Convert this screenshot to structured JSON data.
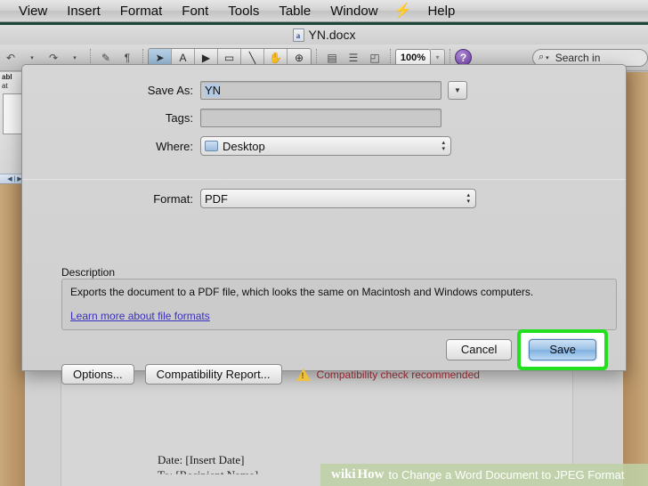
{
  "menubar": {
    "items": [
      {
        "label": "View",
        "name": "menu-view"
      },
      {
        "label": "Insert",
        "name": "menu-insert"
      },
      {
        "label": "Format",
        "name": "menu-format"
      },
      {
        "label": "Font",
        "name": "menu-font"
      },
      {
        "label": "Tools",
        "name": "menu-tools"
      },
      {
        "label": "Table",
        "name": "menu-table"
      },
      {
        "label": "Window",
        "name": "menu-window"
      },
      {
        "label": "Help",
        "name": "menu-help"
      }
    ],
    "flash_icon": "⚡"
  },
  "window": {
    "title": "YN.docx",
    "doc_icon_letter": "a"
  },
  "toolbar": {
    "undo_icon": "↶",
    "redo_icon": "↷",
    "brush_icon": "✎",
    "pilcrow_icon": "¶",
    "tools": [
      {
        "icon": "➤",
        "name": "select-arrow-tool"
      },
      {
        "icon": "A",
        "name": "text-box-tool"
      },
      {
        "icon": "▶",
        "name": "media-tool"
      },
      {
        "icon": "▭",
        "name": "shape-tool"
      },
      {
        "icon": "╲",
        "name": "line-tool"
      },
      {
        "icon": "✋",
        "name": "hand-tool"
      },
      {
        "icon": "⊕",
        "name": "zoom-tool"
      }
    ],
    "sidebar_icon": "▤",
    "notebook_icon": "☰",
    "media_icon": "◰",
    "zoom_value": "100%",
    "zoom_stepper_icon": "▾",
    "help_icon": "?",
    "search_icon": "⌕",
    "search_arrow_icon": "▾",
    "search_placeholder": "Search in"
  },
  "dialog": {
    "save_as": {
      "label": "Save As:",
      "value": "YN",
      "dropdown_icon": "▼"
    },
    "tags": {
      "label": "Tags:",
      "value": "",
      "placeholder": ""
    },
    "where": {
      "label": "Where:",
      "value": "Desktop",
      "stepper_up": "▴",
      "stepper_down": "▾"
    },
    "format": {
      "label": "Format:",
      "value": "PDF",
      "stepper_up": "▴",
      "stepper_down": "▾"
    },
    "description": {
      "label": "Description",
      "text": "Exports the document to a PDF file, which looks the same on Macintosh and Windows computers.",
      "link": "Learn more about file formats"
    },
    "buttons": {
      "options": "Options...",
      "compatibility_report": "Compatibility Report...",
      "warning_icon": "warning-triangle-icon",
      "warning_text": "Compatibility check recommended",
      "cancel": "Cancel",
      "save": "Save"
    },
    "highlight_color": "#22e020",
    "default_button_color": "#9cc1e6"
  },
  "document": {
    "text_lines": [
      "Date: [Insert Date]",
      "To: [Recipient Name]"
    ],
    "accent_color": "#b8561f"
  },
  "sidebar_panel": {
    "line1": "abl",
    "line2": "at",
    "footer": "◀ | ▶"
  },
  "watermark": {
    "wiki": "wiki",
    "how": "How",
    "rest": "to Change a Word Document to JPEG Format"
  }
}
